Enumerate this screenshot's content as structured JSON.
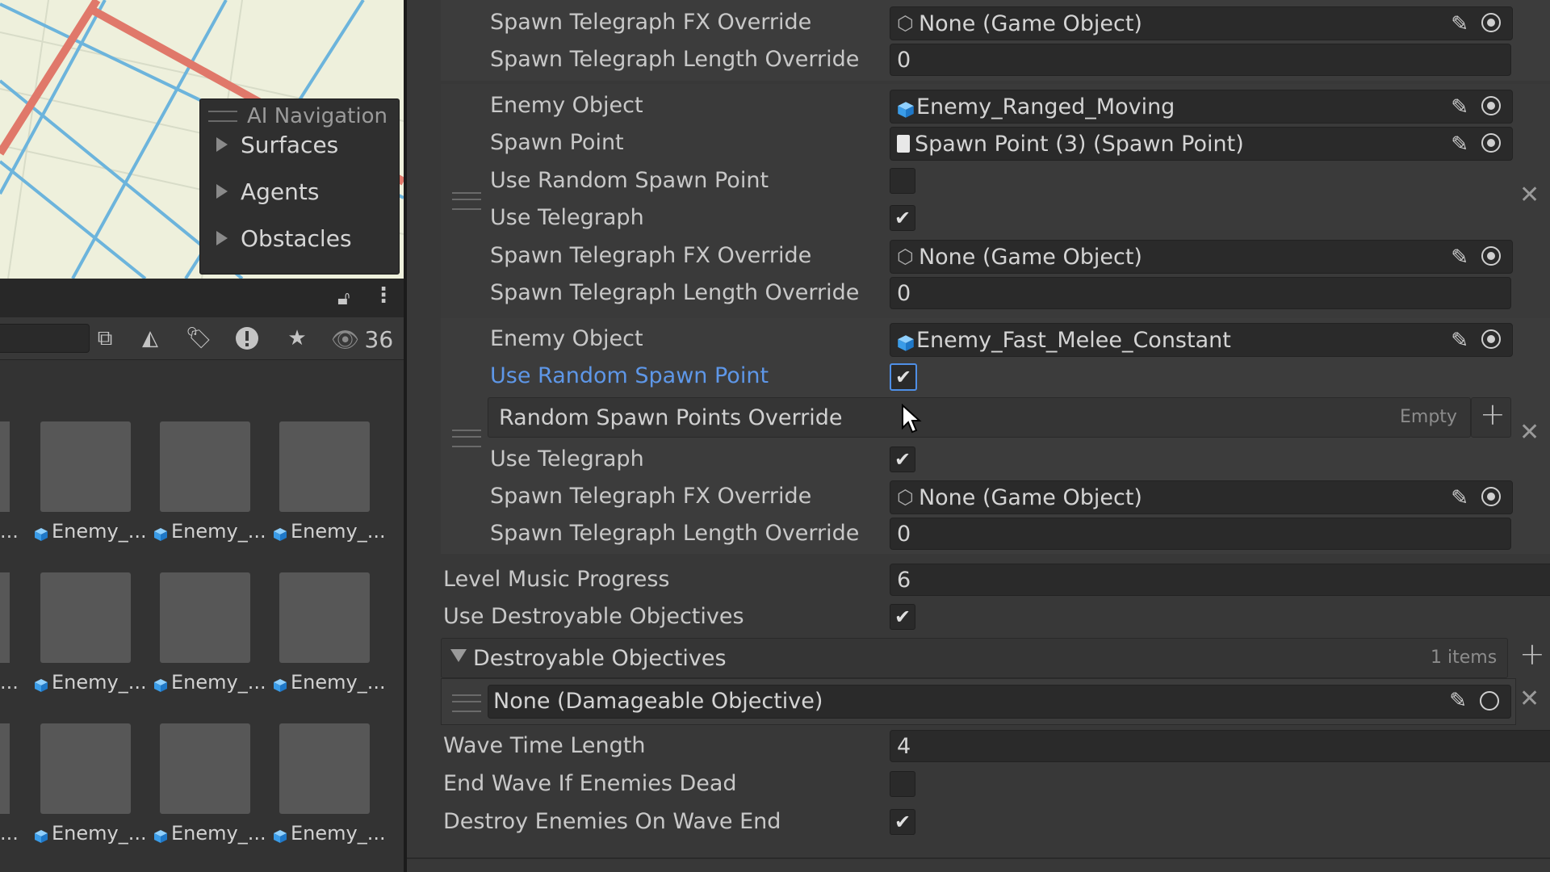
{
  "scene": {
    "overlay_title": "AI Navigation",
    "items": [
      "Surfaces",
      "Agents",
      "Obstacles"
    ]
  },
  "project": {
    "hidden_count": "36",
    "assets": [
      "Enemy_...",
      "Enemy_...",
      "Enemy_...",
      "Enemy_...",
      "Enemy_...",
      "Enemy_...",
      "Enemy_...",
      "Enemy_...",
      "Enemy_..."
    ],
    "partial_label": "..."
  },
  "inspector": {
    "group1": {
      "fx_label": "Spawn Telegraph FX Override",
      "fx_value": "None (Game Object)",
      "len_label": "Spawn Telegraph Length Override",
      "len_value": "0"
    },
    "group2": {
      "enemy_label": "Enemy Object",
      "enemy_value": "Enemy_Ranged_Moving",
      "spawn_label": "Spawn Point",
      "spawn_value": "Spawn Point (3) (Spawn Point)",
      "random_label": "Use Random Spawn Point",
      "telegraph_label": "Use Telegraph",
      "fx_label": "Spawn Telegraph FX Override",
      "fx_value": "None (Game Object)",
      "len_label": "Spawn Telegraph Length Override",
      "len_value": "0"
    },
    "group3": {
      "enemy_label": "Enemy Object",
      "enemy_value": "Enemy_Fast_Melee_Constant",
      "random_label": "Use Random Spawn Point",
      "override_label": "Random Spawn Points Override",
      "override_empty": "Empty",
      "telegraph_label": "Use Telegraph",
      "fx_label": "Spawn Telegraph FX Override",
      "fx_value": "None (Game Object)",
      "len_label": "Spawn Telegraph Length Override",
      "len_value": "0"
    },
    "level_music_label": "Level Music Progress",
    "level_music_value": "6",
    "use_destroyable_label": "Use Destroyable Objectives",
    "destroyable_header": "Destroyable Objectives",
    "destroyable_count": "1 items",
    "destroyable_item": "None (Damageable Objective)",
    "wave_time_label": "Wave Time Length",
    "wave_time_value": "4",
    "end_wave_label": "End Wave If Enemies Dead",
    "destroy_enemies_label": "Destroy Enemies On Wave End"
  },
  "colors": {
    "accent_blue": "#5e97e8",
    "grid_red": "#e0786a",
    "grid_blue": "#6cb4dc"
  }
}
